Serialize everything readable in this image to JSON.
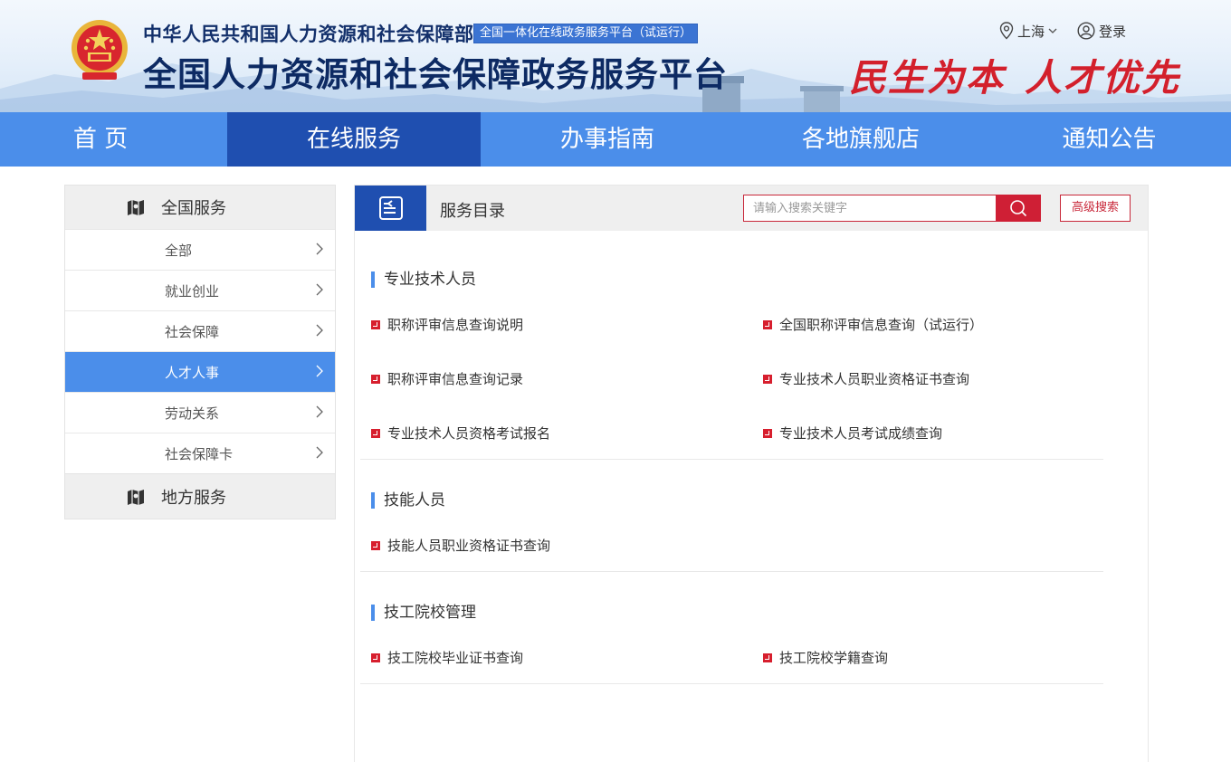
{
  "header": {
    "ministry": "中华人民共和国人力资源和社会保障部",
    "badge": "全国一体化在线政务服务平台（试运行）",
    "platform": "全国人力资源和社会保障政务服务平台",
    "slogan_left": "民生为本",
    "slogan_right": "人才优先",
    "location": "上海",
    "login": "登录"
  },
  "nav": {
    "items": [
      {
        "label": "首 页"
      },
      {
        "label": "在线服务"
      },
      {
        "label": "办事指南"
      },
      {
        "label": "各地旗舰店"
      },
      {
        "label": "通知公告"
      }
    ],
    "active_index": 1
  },
  "sidebar": {
    "national": "全国服务",
    "items": [
      {
        "label": "全部"
      },
      {
        "label": "就业创业"
      },
      {
        "label": "社会保障"
      },
      {
        "label": "人才人事"
      },
      {
        "label": "劳动关系"
      },
      {
        "label": "社会保障卡"
      }
    ],
    "active_index": 3,
    "local": "地方服务"
  },
  "main": {
    "title": "服务目录",
    "search_placeholder": "请输入搜索关键字",
    "advanced_search": "高级搜索",
    "sections": [
      {
        "title": "专业技术人员",
        "links": [
          "职称评审信息查询说明",
          "全国职称评审信息查询（试运行）",
          "职称评审信息查询记录",
          "专业技术人员职业资格证书查询",
          "专业技术人员资格考试报名",
          "专业技术人员考试成绩查询"
        ]
      },
      {
        "title": "技能人员",
        "links": [
          "技能人员职业资格证书查询"
        ]
      },
      {
        "title": "技工院校管理",
        "links": [
          "技工院校毕业证书查询",
          "技工院校学籍查询"
        ]
      }
    ]
  },
  "colors": {
    "nav_blue": "#4b8eea",
    "nav_active": "#1f4fb0",
    "brand_red": "#cf1f35",
    "title_navy": "#0d2a63"
  },
  "icons": {
    "emblem": "national-emblem-icon",
    "location": "location-pin-icon",
    "user": "user-circle-icon",
    "search": "search-icon",
    "catalog": "catalog-icon",
    "map": "map-icon",
    "chevron": "chevron-right-icon",
    "bullet": "arrow-bullet-icon"
  }
}
